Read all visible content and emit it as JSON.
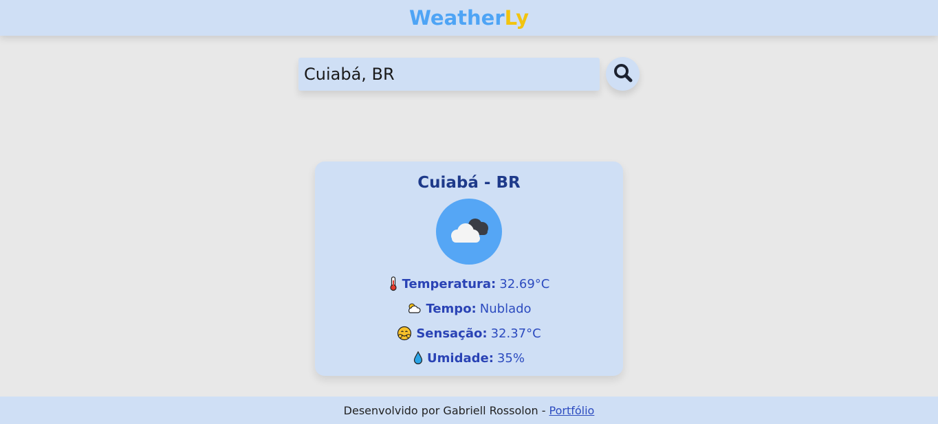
{
  "header": {
    "logo_part1": "Weather",
    "logo_part2": "Ly",
    "logo_colors": {
      "part1": "#4ea4f5",
      "part2": "#f2c40f"
    }
  },
  "search": {
    "value": "Cuiabá, BR",
    "button_icon": "search-icon"
  },
  "card": {
    "city": "Cuiabá - BR",
    "weather_icon": "cloud-icon",
    "rows": [
      {
        "icon": "thermometer-icon",
        "label": "Temperatura:",
        "value": "32.69°C"
      },
      {
        "icon": "cloud-sun-icon",
        "label": "Tempo:",
        "value": "Nublado"
      },
      {
        "icon": "smiling-face-icon",
        "label": "Sensação:",
        "value": "32.37°C"
      },
      {
        "icon": "droplet-icon",
        "label": "Umidade:",
        "value": "35%"
      }
    ]
  },
  "footer": {
    "text": "Desenvolvido por Gabriell Rossolon -",
    "link": "Portfólio"
  },
  "colors": {
    "background": "#e8e8e8",
    "panel": "#cfdff5",
    "accent_blue": "#55a6f5",
    "text_blue": "#2c4bbf"
  }
}
